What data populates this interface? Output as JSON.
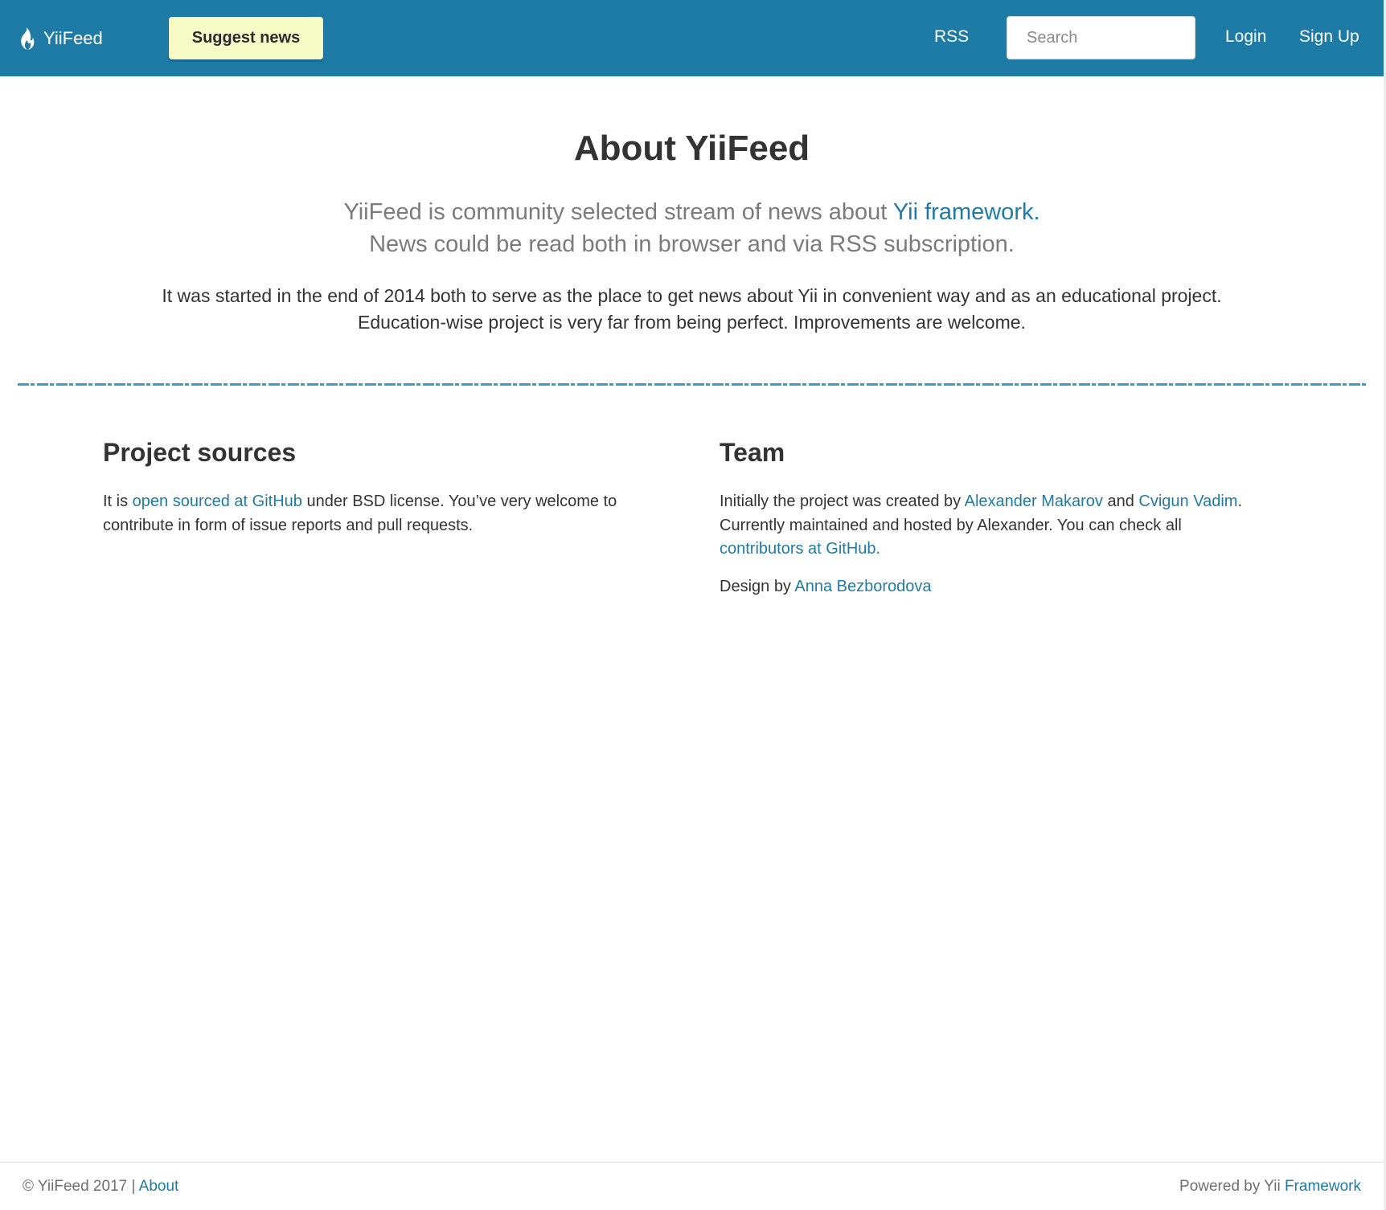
{
  "navbar": {
    "brand": "YiiFeed",
    "brand_icon": "flame-icon",
    "suggest_label": "Suggest news",
    "rss_label": "RSS",
    "search_placeholder": "Search",
    "login_label": "Login",
    "signup_label": "Sign Up"
  },
  "hero": {
    "title": "About YiiFeed",
    "lead_prefix": "YiiFeed is community selected stream of news about ",
    "lead_link": "Yii framework.",
    "lead_line2": "News could be read both in browser and via RSS subscription.",
    "intro_line1": "It was started in the end of 2014 both to serve as the place to get news about Yii in convenient way and as an educational project.",
    "intro_line2": "Education-wise project is very far from being perfect. Improvements are welcome."
  },
  "sources": {
    "heading": "Project sources",
    "text_prefix": "It is ",
    "link": "open sourced at GitHub",
    "text_suffix": " under BSD license. You’ve very welcome to contribute in form of issue reports and pull requests."
  },
  "team": {
    "heading": "Team",
    "p1_prefix": "Initially the project was created by ",
    "author1": "Alexander Makarov",
    "and": " and ",
    "author2": "Cvigun Vadim",
    "p1_mid": ". Currently maintained and hosted by Alexander. You can check all ",
    "contributors_link": "contributors at GitHub.",
    "design_prefix": "Design by ",
    "designer": "Anna Bezborodova"
  },
  "footer": {
    "copyright": "© YiiFeed 2017 | ",
    "about_link": "About",
    "powered_prefix": "Powered by Yii ",
    "framework_link": "Framework"
  },
  "colors": {
    "navbar": "#1e7ba6",
    "suggest_button": "#f6fbc5",
    "link": "#1e7ba6",
    "divider": "#3a9cc9"
  }
}
